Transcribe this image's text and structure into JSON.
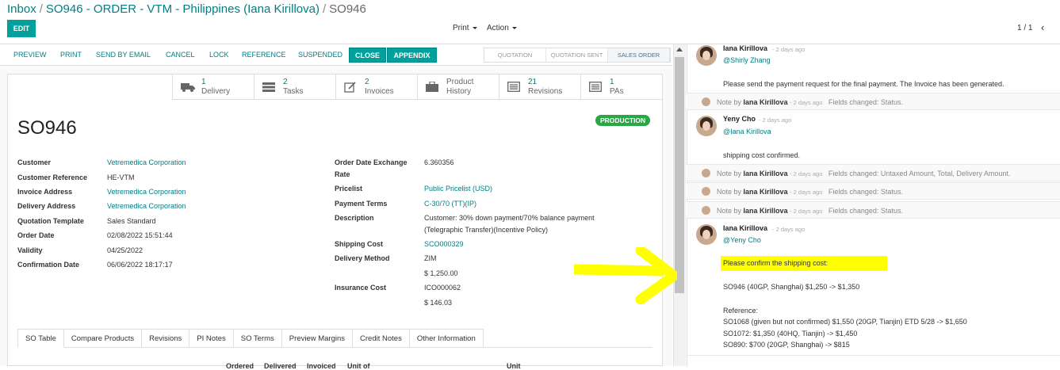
{
  "breadcrumb": {
    "inbox": "Inbox",
    "order": "SO946 - ORDER - VTM - Philippines (Iana Kirillova)",
    "current": "SO946",
    "sep": "/"
  },
  "toolbar": {
    "edit": "EDIT",
    "print": "Print",
    "action": "Action",
    "pager": "1 / 1",
    "prev": "‹"
  },
  "statusbar": {
    "buttons": [
      "PREVIEW",
      "PRINT",
      "SEND BY EMAIL",
      "CANCEL",
      "LOCK",
      "REFERENCE",
      "SUSPENDED"
    ],
    "close": "CLOSE",
    "appendix": "APPENDIX",
    "stages": [
      "QUOTATION",
      "QUOTATION SENT",
      "SALES ORDER"
    ]
  },
  "smart_buttons": [
    {
      "num": "1",
      "label": "Delivery",
      "icon": "truck-icon"
    },
    {
      "num": "2",
      "label": "Tasks",
      "icon": "tasks-icon"
    },
    {
      "num": "2",
      "label": "Invoices",
      "icon": "invoice-icon"
    },
    {
      "num": "",
      "label1": "Product",
      "label": "History",
      "icon": "briefcase-icon"
    },
    {
      "num": "21",
      "label": "Revisions",
      "icon": "list-icon"
    },
    {
      "num": "1",
      "label": "PAs",
      "icon": "list-icon"
    }
  ],
  "order": {
    "name": "SO946",
    "badge": "PRODUCTION"
  },
  "left_fields": [
    {
      "label": "Customer",
      "value": "Vetremedica Corporation",
      "link": true
    },
    {
      "label": "Customer Reference",
      "value": "HE-VTM",
      "link": false
    },
    {
      "label": "Invoice Address",
      "value": "Vetremedica Corporation",
      "link": true
    },
    {
      "label": "Delivery Address",
      "value": "Vetremedica Corporation",
      "link": true
    },
    {
      "label": "Quotation Template",
      "value": "Sales Standard",
      "link": false
    },
    {
      "label": "Order Date",
      "value": "02/08/2022 15:51:44",
      "link": false
    },
    {
      "label": "Validity",
      "value": "04/25/2022",
      "link": false
    },
    {
      "label": "Confirmation Date",
      "value": "06/06/2022 18:17:17",
      "link": false
    }
  ],
  "right_fields": {
    "exchange_label1": "Order Date Exchange",
    "exchange_label2": "Rate",
    "exchange_value": "6.360356",
    "pricelist_label": "Pricelist",
    "pricelist_value": "Public Pricelist (USD)",
    "terms_label": "Payment Terms",
    "terms_value": "C-30/70 (TT)(IP)",
    "desc_label": "Description",
    "desc_line1": "Customer: 30% down payment/70% balance payment",
    "desc_line2": "(Telegraphic Transfer)(Incentive Policy)",
    "shipping_label": "Shipping Cost",
    "shipping_value": "SCO000329",
    "delivery_label": "Delivery Method",
    "delivery_value": "ZIM",
    "delivery_amount": "$ 1,250.00",
    "insurance_label": "Insurance Cost",
    "insurance_value": "ICO000062",
    "insurance_amount": "$ 146.03"
  },
  "tabs": [
    "SO Table",
    "Compare Products",
    "Revisions",
    "PI Notes",
    "SO Terms",
    "Preview Margins",
    "Credit Notes",
    "Other Information"
  ],
  "table_headers": [
    "Ordered",
    "Delivered",
    "Invoiced",
    "Unit of",
    "Unit"
  ],
  "chatter": {
    "m1": {
      "author": "Iana Kirillova",
      "date": "- 2 days ago",
      "mention": "@Shirly Zhang",
      "body": "Please send the payment request for the final payment. The Invoice has been generated."
    },
    "n1": {
      "prefix": "Note by",
      "author": "Iana Kirillova",
      "date": "- 2 days ago",
      "text": "Fields changed: Status."
    },
    "m2": {
      "author": "Yeny Cho",
      "date": "- 2 days ago",
      "mention": "@Iana Kirillova",
      "body": "shipping cost confirmed."
    },
    "n2": {
      "prefix": "Note by",
      "author": "Iana Kirillova",
      "date": "- 2 days ago",
      "text": "Fields changed: Untaxed Amount, Total, Delivery Amount."
    },
    "n3": {
      "prefix": "Note by",
      "author": "Iana Kirillova",
      "date": "- 2 days ago",
      "text": "Fields changed: Status."
    },
    "n4": {
      "prefix": "Note by",
      "author": "Iana Kirillova",
      "date": "- 2 days ago",
      "text": "Fields changed: Status."
    },
    "m3": {
      "author": "Iana Kirillova",
      "date": "- 2 days ago",
      "mention": "@Yeny Cho",
      "lines": [
        "Please confirm the shipping cost:",
        "SO946 (40GP, Shanghai) $1,250 -> $1,350",
        "Reference:",
        "SO1068 (given but not confirmed) $1,550 (20GP, Tianjin) ETD 5/28 -> $1,650",
        "SO1072: $1,350 (40HQ, Tianjin) -> $1,450",
        "SO890: $700 (20GP, Shanghai) -> $815"
      ]
    }
  },
  "colors": {
    "primary": "#00a09d",
    "link": "#017e84",
    "badge": "#28a745",
    "highlight": "#ffff00"
  }
}
